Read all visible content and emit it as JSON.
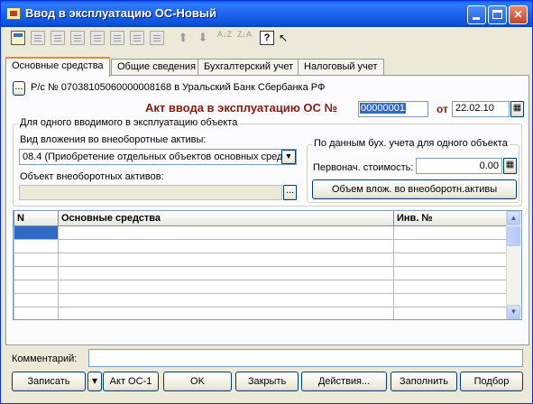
{
  "window": {
    "title": "Ввод в эксплуатацию ОС-Новый",
    "controls": [
      "minimize-icon",
      "maximize-icon",
      "close-icon"
    ]
  },
  "toolbar": {
    "icons": [
      "new-document-icon",
      "copy-row-icon",
      "edit-row-icon",
      "delete-row-icon",
      "end-edit-icon",
      "mark-delete-icon",
      "up-level-icon",
      "move-up-icon",
      "move-down-icon",
      "sort-asc-icon",
      "sort-desc-icon",
      "help-icon",
      "whats-this-icon"
    ],
    "help_glyph": "?",
    "move_up_glyph": "⬆",
    "move_down_glyph": "⬇",
    "sort_asc_glyph": "A↓Z",
    "sort_desc_glyph": "Z↓A"
  },
  "tabs": [
    "Основные средства",
    "Общие сведения",
    "Бухгалтерский учет",
    "Налоговый учет"
  ],
  "active_tab": "Основные средства",
  "header": {
    "account_button": "...",
    "account_text": "Р/с № 07038105060000008168 в Уральский Банк Сбербанка РФ",
    "doc_title": "Акт ввода в эксплуатацию ОС №",
    "doc_number": "00000001",
    "date_prefix": "от",
    "doc_date": "22.02.10",
    "title_color": "#8b1a10"
  },
  "single_object": {
    "group_title": "Для одного вводимого в эксплуатацию объекта",
    "investment_type_label": "Вид вложения во внеоборотные активы:",
    "investment_type_value": "08.4 (Приобретение отдельных объектов основных сред",
    "object_label": "Объект внеоборотных активов:",
    "object_value": "",
    "object_button": "..."
  },
  "accounting": {
    "group_title": "По данным бух. учета для одного объекта",
    "initial_cost_label": "Первонач. стоимость:",
    "initial_cost_value": "0.00",
    "investment_volume_button": "Объем влож. во внеоборотн.активы"
  },
  "table": {
    "columns": [
      "N",
      "Основные средства",
      "Инв. №"
    ],
    "rows": [
      [
        "",
        "",
        ""
      ],
      [
        "",
        "",
        ""
      ],
      [
        "",
        "",
        ""
      ],
      [
        "",
        "",
        ""
      ],
      [
        "",
        "",
        ""
      ],
      [
        "",
        "",
        ""
      ],
      [
        "",
        "",
        ""
      ]
    ]
  },
  "comment": {
    "label": "Комментарий:",
    "value": ""
  },
  "footer": {
    "save": "Записать",
    "save_dropdown": "▾",
    "act": "Акт ОС-1",
    "ok": "OK",
    "close": "Закрыть",
    "actions": "Действия...",
    "fill": "Заполнить",
    "select": "Подбор"
  },
  "colors": {
    "titlebar": "#0a50d8",
    "selection": "#316ac5",
    "active_tab_accent": "#e68b2c"
  }
}
